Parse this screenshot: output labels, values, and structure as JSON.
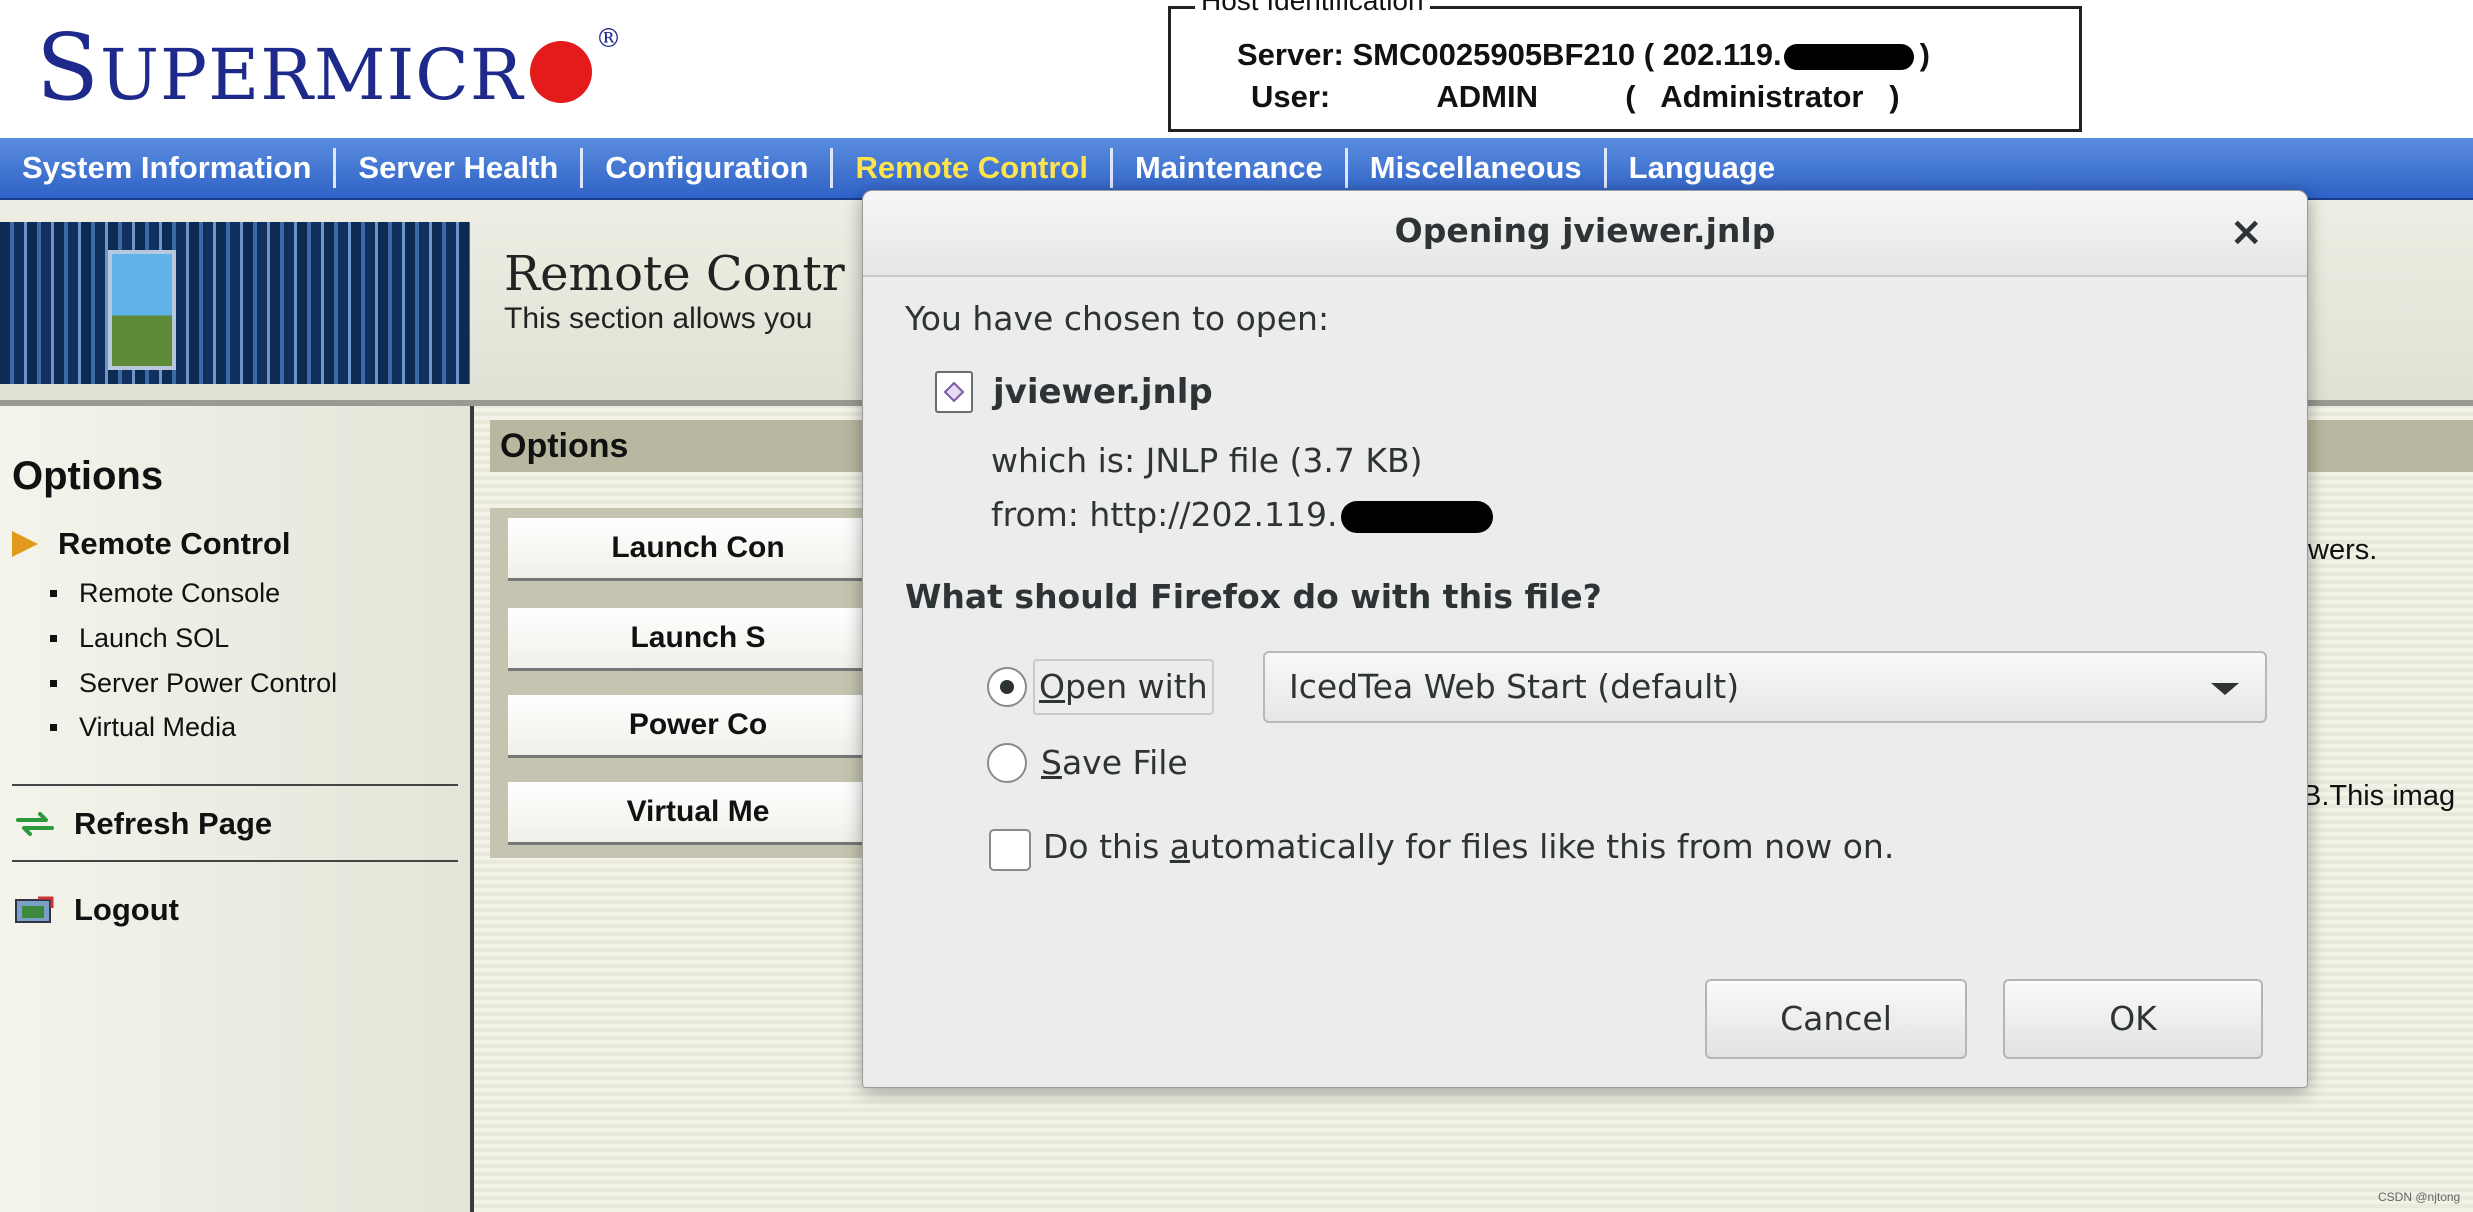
{
  "header": {
    "logo_text": "SUPERMICRO",
    "logo_registered": "®",
    "host_box": {
      "legend": "Host Identification",
      "server_label": "Server:",
      "server_value": "SMC0025905BF210 ( 202.119.",
      "server_close": ")",
      "user_label": "User:",
      "user_value": "ADMIN",
      "user_role": "(   Administrator   )"
    }
  },
  "nav": {
    "items": [
      {
        "label": "System Information",
        "active": false
      },
      {
        "label": "Server Health",
        "active": false
      },
      {
        "label": "Configuration",
        "active": false
      },
      {
        "label": "Remote Control",
        "active": true
      },
      {
        "label": "Maintenance",
        "active": false
      },
      {
        "label": "Miscellaneous",
        "active": false
      },
      {
        "label": "Language",
        "active": false
      }
    ]
  },
  "banner": {
    "title": "Remote Contr",
    "subtitle": "This section allows you"
  },
  "sidebar": {
    "title": "Options",
    "active_item": "Remote Control",
    "sub_items": [
      "Remote Console",
      "Launch SOL",
      "Server Power Control",
      "Virtual Media"
    ],
    "refresh": "Refresh Page",
    "logout": "Logout"
  },
  "content": {
    "options_header": "Options",
    "buttons": [
      "Launch Con",
      "Launch S",
      "Power Co",
      "Virtual Me"
    ],
    "right_text_1": "wers.",
    "right_text_2": "B.This imag",
    "watermark": "CSDN @njtong"
  },
  "dialog": {
    "title": "Opening jviewer.jnlp",
    "close_glyph": "×",
    "intro": "You have chosen to open:",
    "file_name": "jviewer.jnlp",
    "which_is": "which is: JNLP file (3.7 KB)",
    "from": "from: http://202.119.",
    "question": "What should Firefox do with this file?",
    "open_with_pre": "",
    "open_with_underlined": "O",
    "open_with_rest": "pen with",
    "application": "IcedTea Web Start (default)",
    "save_underlined": "S",
    "save_rest": "ave File",
    "auto_pre": "Do this ",
    "auto_underlined": "a",
    "auto_rest": "utomatically for files like this from now on.",
    "cancel": "Cancel",
    "ok": "OK",
    "open_with_selected": true,
    "auto_checked": false
  },
  "colors": {
    "nav_bg": "#3f72d0",
    "nav_active": "#ffe34d",
    "logo_blue": "#1d2a8c",
    "logo_red": "#e41b1b",
    "sidebar_arrow": "#e19a1c"
  }
}
